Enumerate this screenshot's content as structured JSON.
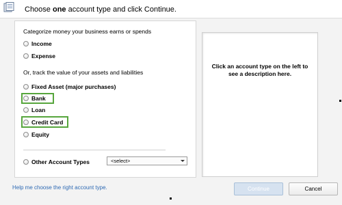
{
  "header": {
    "title_before": "Choose ",
    "title_emphasis": "one",
    "title_after": " account type and click Continue."
  },
  "left_panel": {
    "categorize_label": "Categorize money your business earns or spends",
    "track_label": "Or, track the value of your assets and liabilities",
    "income_option": "Income",
    "expense_option": "Expense",
    "fixed_asset_option": "Fixed Asset (major purchases)",
    "bank_option": "Bank",
    "loan_option": "Loan",
    "credit_card_option": "Credit Card",
    "equity_option": "Equity",
    "other_option": "Other Account Types",
    "other_select_value": "<select>"
  },
  "description_panel": {
    "text": "Click an account type on the left to see a description here."
  },
  "footer": {
    "help_link": "Help me choose the right account type.",
    "continue_label": "Continue",
    "cancel_label": "Cancel"
  },
  "colors": {
    "highlight": "#56a53c",
    "link": "#2d69b3"
  }
}
